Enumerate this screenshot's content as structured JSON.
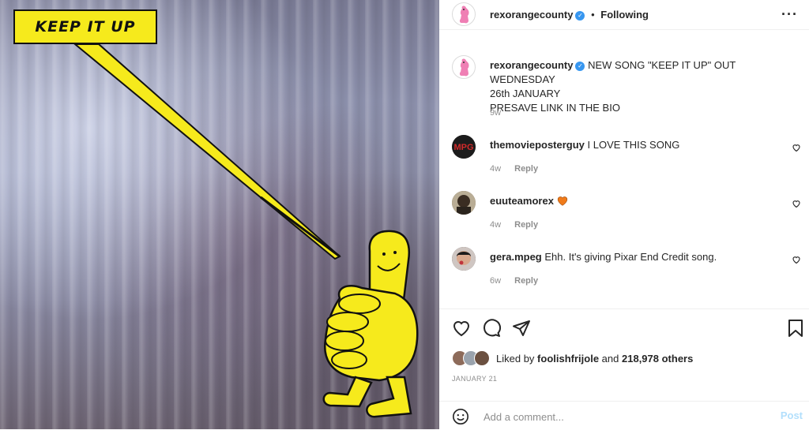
{
  "post": {
    "image": {
      "caption_text": "KEEP IT UP",
      "colors": {
        "banner": "#f6ea1c",
        "figure": "#f6ea1c",
        "outline": "#111111"
      }
    },
    "author": {
      "username": "rexorangecounty",
      "verified": true
    },
    "follow_state": "Following",
    "separator": "•",
    "more_icon": "more-dots-icon",
    "caption": {
      "username": "rexorangecounty",
      "line1": "NEW SONG \"KEEP IT UP\" OUT WEDNESDAY",
      "line2": "26th JANUARY",
      "line3": "PRESAVE LINK IN THE BIO",
      "age": "9w"
    },
    "comments": [
      {
        "username": "themovieposterguy",
        "text": "I LOVE THIS SONG",
        "age": "4w",
        "reply": "Reply"
      },
      {
        "username": "euuteamorex",
        "text": "",
        "emoji": "orange-heart",
        "age": "4w",
        "reply": "Reply"
      },
      {
        "username": "gera.mpeg",
        "text": "Ehh. It's giving Pixar End Credit song.",
        "age": "6w",
        "reply": "Reply"
      }
    ],
    "likes": {
      "prefix": "Liked by",
      "first": "foolishfrijole",
      "connector": "and",
      "others": "218,978 others"
    },
    "date": "JANUARY 21",
    "add_comment": {
      "placeholder": "Add a comment...",
      "post_label": "Post"
    },
    "colors": {
      "accent": "#3897f0",
      "post_disabled": "#b2dffc",
      "muted": "#8e8e8e",
      "heart": "#f07b1a"
    }
  }
}
